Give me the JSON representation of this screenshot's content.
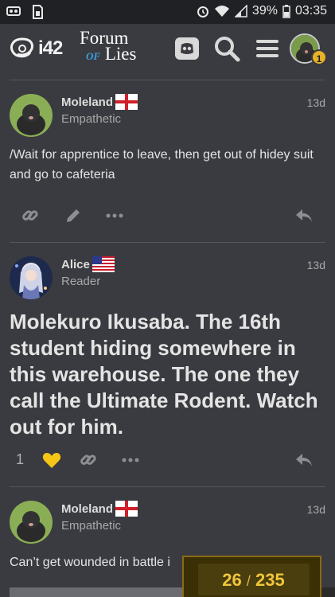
{
  "statusbar": {
    "battery_percent": "39%",
    "time": "03:35"
  },
  "header": {
    "logo_text": "i42",
    "forum_name_line1": "Forum",
    "forum_name_of": "OF",
    "forum_name_line2": "Lies",
    "notification_count": "1"
  },
  "posts": [
    {
      "username": "Moleland",
      "user_title": "Empathetic",
      "time": "13d",
      "flag": "england",
      "body": "/Wait for apprentice to leave, then get out of hidey suit and go to cafeteria",
      "like_count": ""
    },
    {
      "username": "Alice",
      "user_title": "Reader",
      "time": "13d",
      "flag": "usa",
      "body": "Molekuro Ikusaba. The 16th student hiding somewhere in this warehouse. The one they call the Ultimate Rodent. Watch out for him.",
      "like_count": "1"
    },
    {
      "username": "Moleland",
      "user_title": "Empathetic",
      "time": "13d",
      "flag": "england",
      "body": "Can’t get wounded in battle i",
      "like_count": ""
    }
  ],
  "progress": {
    "current": "26",
    "separator": "/",
    "total": "235"
  },
  "colors": {
    "background": "#3a3b40",
    "accent_gold": "#f0c63a",
    "heart": "#f5c518",
    "text": "#dddddd"
  },
  "icons": [
    "alarm-icon",
    "wifi-icon",
    "signal-icon",
    "battery-icon",
    "discord-icon",
    "search-icon",
    "hamburger-menu-icon",
    "link-icon",
    "edit-icon",
    "more-icon",
    "reply-icon",
    "heart-icon"
  ]
}
